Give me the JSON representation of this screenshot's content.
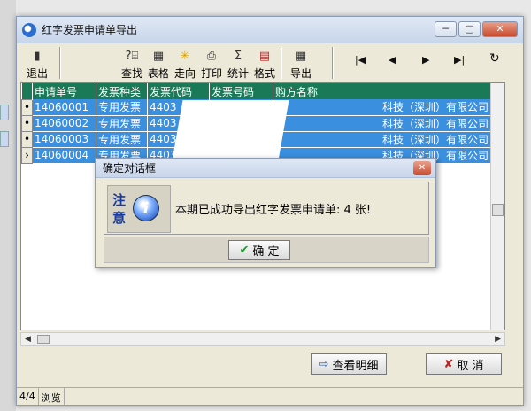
{
  "window": {
    "title": "红字发票申请单导出",
    "ctrl_min": "─",
    "ctrl_max": "□",
    "ctrl_close": "✕"
  },
  "toolbar": {
    "exit": "退出",
    "find": "查找",
    "table": "表格",
    "direction": "走向",
    "print": "打印",
    "stats": "统计",
    "format": "格式",
    "export": "导出",
    "nav_first": "|◀",
    "nav_prev": "◀",
    "nav_next": "▶",
    "nav_last": "▶|",
    "refresh": "↻"
  },
  "grid": {
    "columns": [
      "申请单号",
      "发票种类",
      "发票代码",
      "发票号码",
      "购方名称"
    ],
    "rows": [
      {
        "marker": "•",
        "cells": [
          "14060001",
          "专用发票",
          "4403",
          "",
          "科技（深圳）有限公司"
        ]
      },
      {
        "marker": "•",
        "cells": [
          "14060002",
          "专用发票",
          "4403",
          "",
          "科技（深圳）有限公司"
        ]
      },
      {
        "marker": "•",
        "cells": [
          "14060003",
          "专用发票",
          "4403",
          "",
          "科技（深圳）有限公司"
        ]
      },
      {
        "marker": "›",
        "cells": [
          "14060004",
          "专用发票",
          "4403",
          "",
          "科技（深圳）有限公司"
        ]
      }
    ]
  },
  "buttons": {
    "view_detail": "查看明细",
    "cancel": "取 消"
  },
  "status": {
    "record": "4/4",
    "mode": "浏览"
  },
  "dialog": {
    "title": "确定对话框",
    "notice_chars": "注意",
    "info_glyph": "i",
    "message": "本期已成功导出红字发票申请单: 4 张!",
    "ok": "确 定"
  },
  "colors": {
    "header_bg": "#1a7a58",
    "selected_row": "#3a8fde"
  }
}
